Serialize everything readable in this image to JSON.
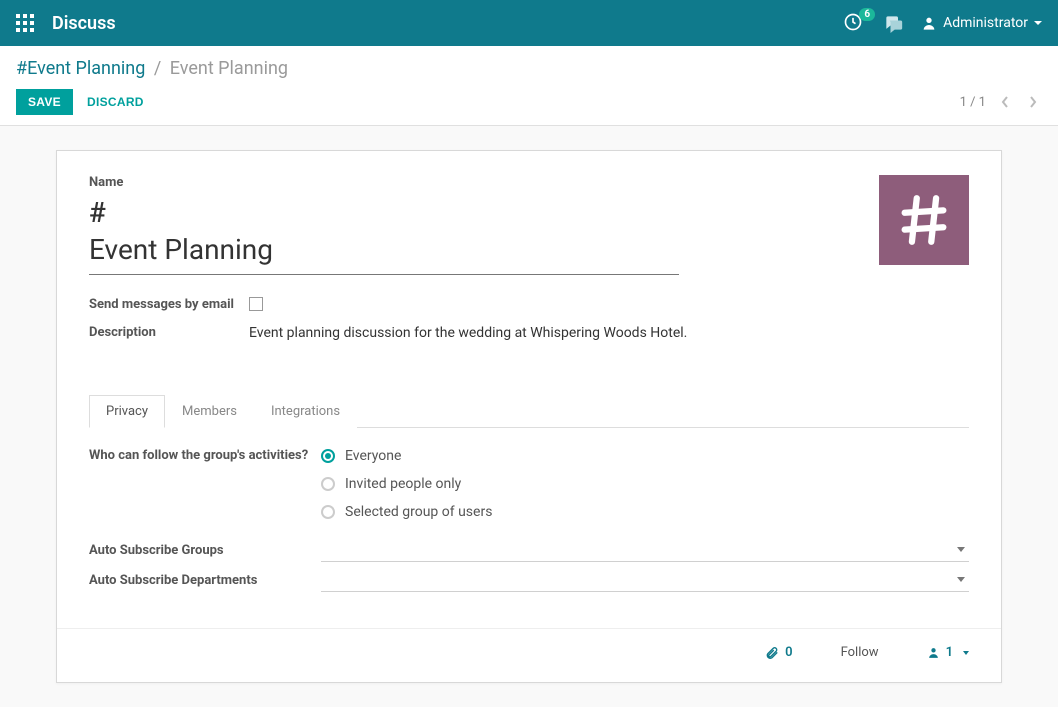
{
  "topnav": {
    "brand": "Discuss",
    "clock_badge": "6",
    "user_name": "Administrator"
  },
  "breadcrumbs": {
    "parent": "#Event Planning",
    "current": "Event Planning"
  },
  "actions": {
    "save": "SAVE",
    "discard": "DISCARD"
  },
  "pager": {
    "text": "1 / 1"
  },
  "form": {
    "name_label": "Name",
    "hash": "#",
    "name_value": "Event Planning",
    "send_email_label": "Send messages by email",
    "send_email_checked": false,
    "description_label": "Description",
    "description_value": "Event planning discussion for the wedding at Whispering Woods Hotel."
  },
  "tabs": {
    "items": [
      {
        "label": "Privacy",
        "active": true
      },
      {
        "label": "Members",
        "active": false
      },
      {
        "label": "Integrations",
        "active": false
      }
    ]
  },
  "privacy": {
    "question": "Who can follow the group's activities?",
    "options": [
      {
        "label": "Everyone",
        "checked": true
      },
      {
        "label": "Invited people only",
        "checked": false
      },
      {
        "label": "Selected group of users",
        "checked": false
      }
    ],
    "auto_groups_label": "Auto Subscribe Groups",
    "auto_depts_label": "Auto Subscribe Departments"
  },
  "chatter": {
    "attach_count": "0",
    "follow_label": "Follow",
    "follower_count": "1"
  },
  "colors": {
    "primary": "#0f7a8c",
    "accent": "#00a09d",
    "avatar_bg": "#8e5d7b"
  }
}
